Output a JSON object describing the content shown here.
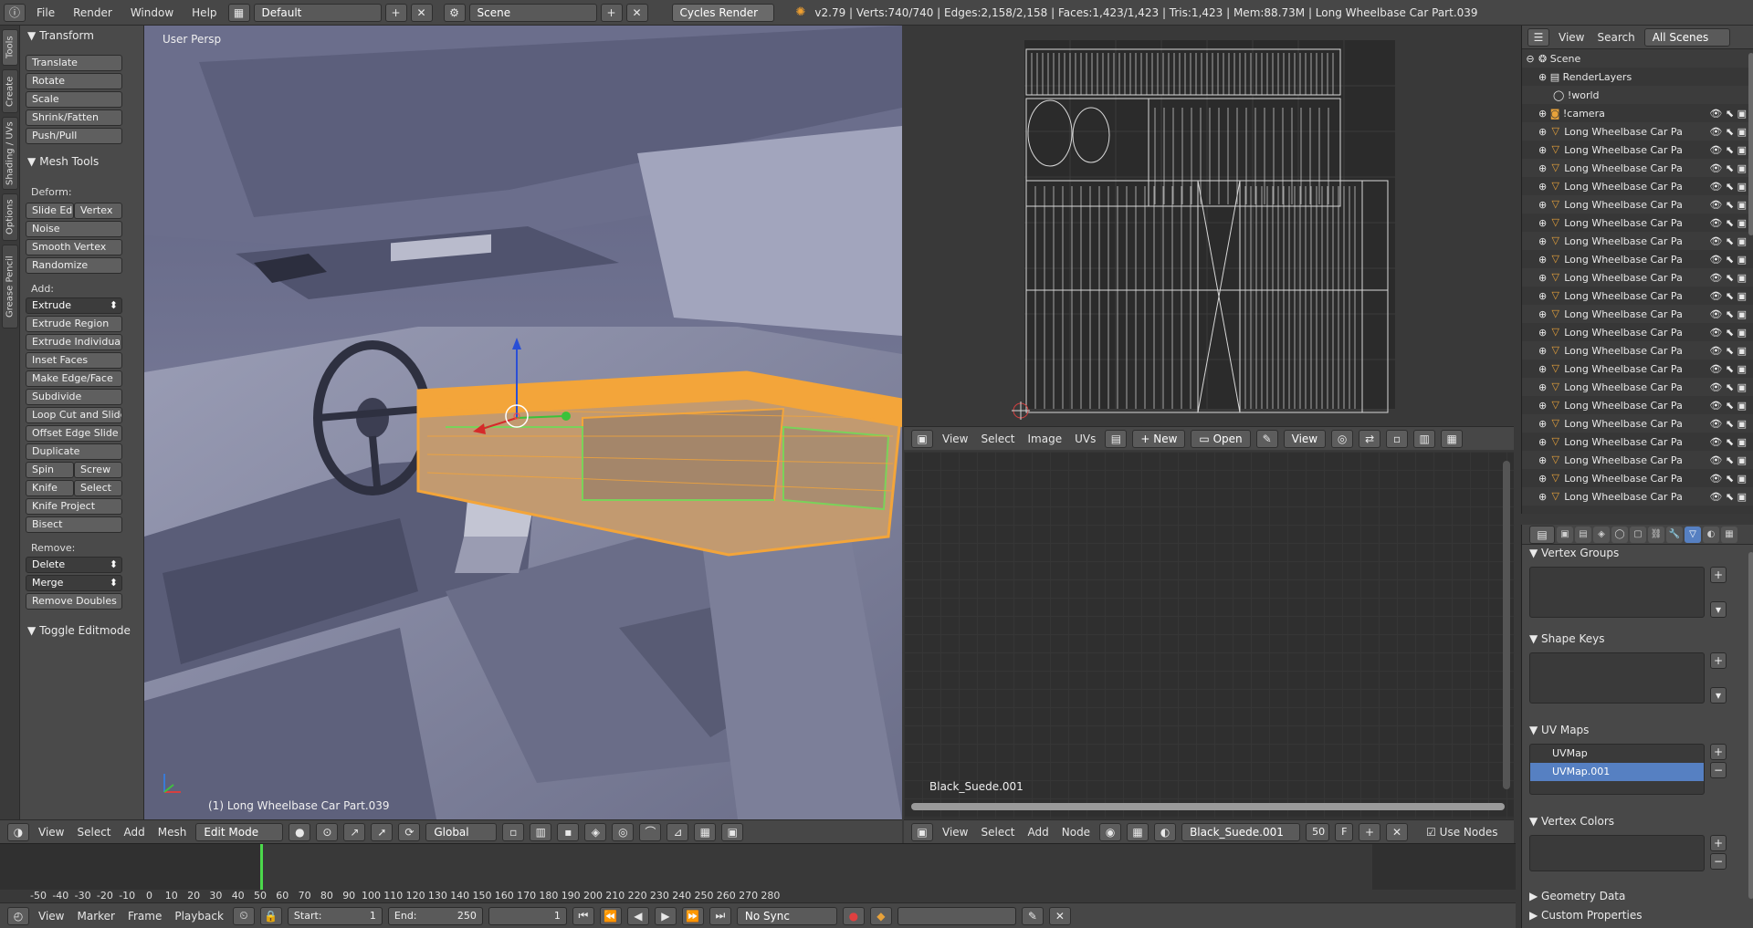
{
  "topbar": {
    "menus": [
      "File",
      "Render",
      "Window",
      "Help"
    ],
    "layout": "Default",
    "scene": "Scene",
    "engine": "Cycles Render",
    "stats": "v2.79 | Verts:740/740 | Edges:2,158/2,158 | Faces:1,423/1,423 | Tris:1,423 | Mem:88.73M | Long Wheelbase Car Part.039"
  },
  "tabstrip": [
    "Tools",
    "Create",
    "Shading / UVs",
    "Options",
    "Grease Pencil"
  ],
  "toolshelf": {
    "transform_title": "Transform",
    "transform": [
      "Translate",
      "Rotate",
      "Scale",
      "Shrink/Fatten",
      "Push/Pull"
    ],
    "mesh_tools_title": "Mesh Tools",
    "deform_label": "Deform:",
    "slide_edge": "Slide Ed",
    "vertex": "Vertex",
    "deform": [
      "Noise",
      "Smooth Vertex",
      "Randomize"
    ],
    "add_label": "Add:",
    "extrude": "Extrude",
    "add": [
      "Extrude Region",
      "Extrude Individual",
      "Inset Faces",
      "Make Edge/Face",
      "Subdivide",
      "Loop Cut and Slide",
      "Offset Edge Slide",
      "Duplicate"
    ],
    "spin": "Spin",
    "screw": "Screw",
    "knife": "Knife",
    "select": "Select",
    "knife_project": "Knife Project",
    "bisect": "Bisect",
    "remove_label": "Remove:",
    "delete": "Delete",
    "merge": "Merge",
    "remove_doubles": "Remove Doubles",
    "toggle_editmode": "Toggle Editmode"
  },
  "viewport": {
    "view_label": "User Persp",
    "object_label": "(1) Long Wheelbase Car Part.039"
  },
  "viewport_header": {
    "menus": [
      "View",
      "Select",
      "Add",
      "Mesh"
    ],
    "mode": "Edit Mode",
    "orientation": "Global"
  },
  "uv_header": {
    "menus": [
      "View",
      "Select",
      "Image",
      "UVs"
    ],
    "new": "New",
    "open": "Open",
    "view": "View"
  },
  "node_editor": {
    "material_label": "Black_Suede.001",
    "menus": [
      "View",
      "Select",
      "Add",
      "Node"
    ],
    "material": "Black_Suede.001",
    "users": "50",
    "fake": "F",
    "use_nodes": "Use Nodes"
  },
  "outliner": {
    "menus": [
      "View",
      "Search"
    ],
    "filter": "All Scenes",
    "scene": "Scene",
    "renderlayers": "RenderLayers",
    "world": "!world",
    "camera": "!camera",
    "parts": [
      "Long Wheelbase Car Pa",
      "Long Wheelbase Car Pa",
      "Long Wheelbase Car Pa",
      "Long Wheelbase Car Pa",
      "Long Wheelbase Car Pa",
      "Long Wheelbase Car Pa",
      "Long Wheelbase Car Pa",
      "Long Wheelbase Car Pa",
      "Long Wheelbase Car Pa",
      "Long Wheelbase Car Pa",
      "Long Wheelbase Car Pa",
      "Long Wheelbase Car Pa",
      "Long Wheelbase Car Pa",
      "Long Wheelbase Car Pa",
      "Long Wheelbase Car Pa",
      "Long Wheelbase Car Pa",
      "Long Wheelbase Car Pa",
      "Long Wheelbase Car Pa",
      "Long Wheelbase Car Pa",
      "Long Wheelbase Car Pa",
      "Long Wheelbase Car Pa"
    ]
  },
  "properties": {
    "vertex_groups": "Vertex Groups",
    "shape_keys": "Shape Keys",
    "uv_maps": "UV Maps",
    "uvmap_items": [
      "UVMap",
      "UVMap.001"
    ],
    "vertex_colors": "Vertex Colors",
    "geometry_data": "Geometry Data",
    "custom_properties": "Custom Properties"
  },
  "timeline": {
    "ticks": [
      "-50",
      "-40",
      "-30",
      "-20",
      "-10",
      "0",
      "10",
      "20",
      "30",
      "40",
      "50",
      "60",
      "70",
      "80",
      "90",
      "100",
      "110",
      "120",
      "130",
      "140",
      "150",
      "160",
      "170",
      "180",
      "190",
      "200",
      "210",
      "220",
      "230",
      "240",
      "250",
      "260",
      "270",
      "280"
    ],
    "menus": [
      "View",
      "Marker",
      "Frame",
      "Playback"
    ],
    "start_label": "Start:",
    "start": "1",
    "end_label": "End:",
    "end": "250",
    "current": "1",
    "sync": "No Sync"
  },
  "colors": {
    "selection": "#f3a53a",
    "accent": "#5680c2"
  }
}
